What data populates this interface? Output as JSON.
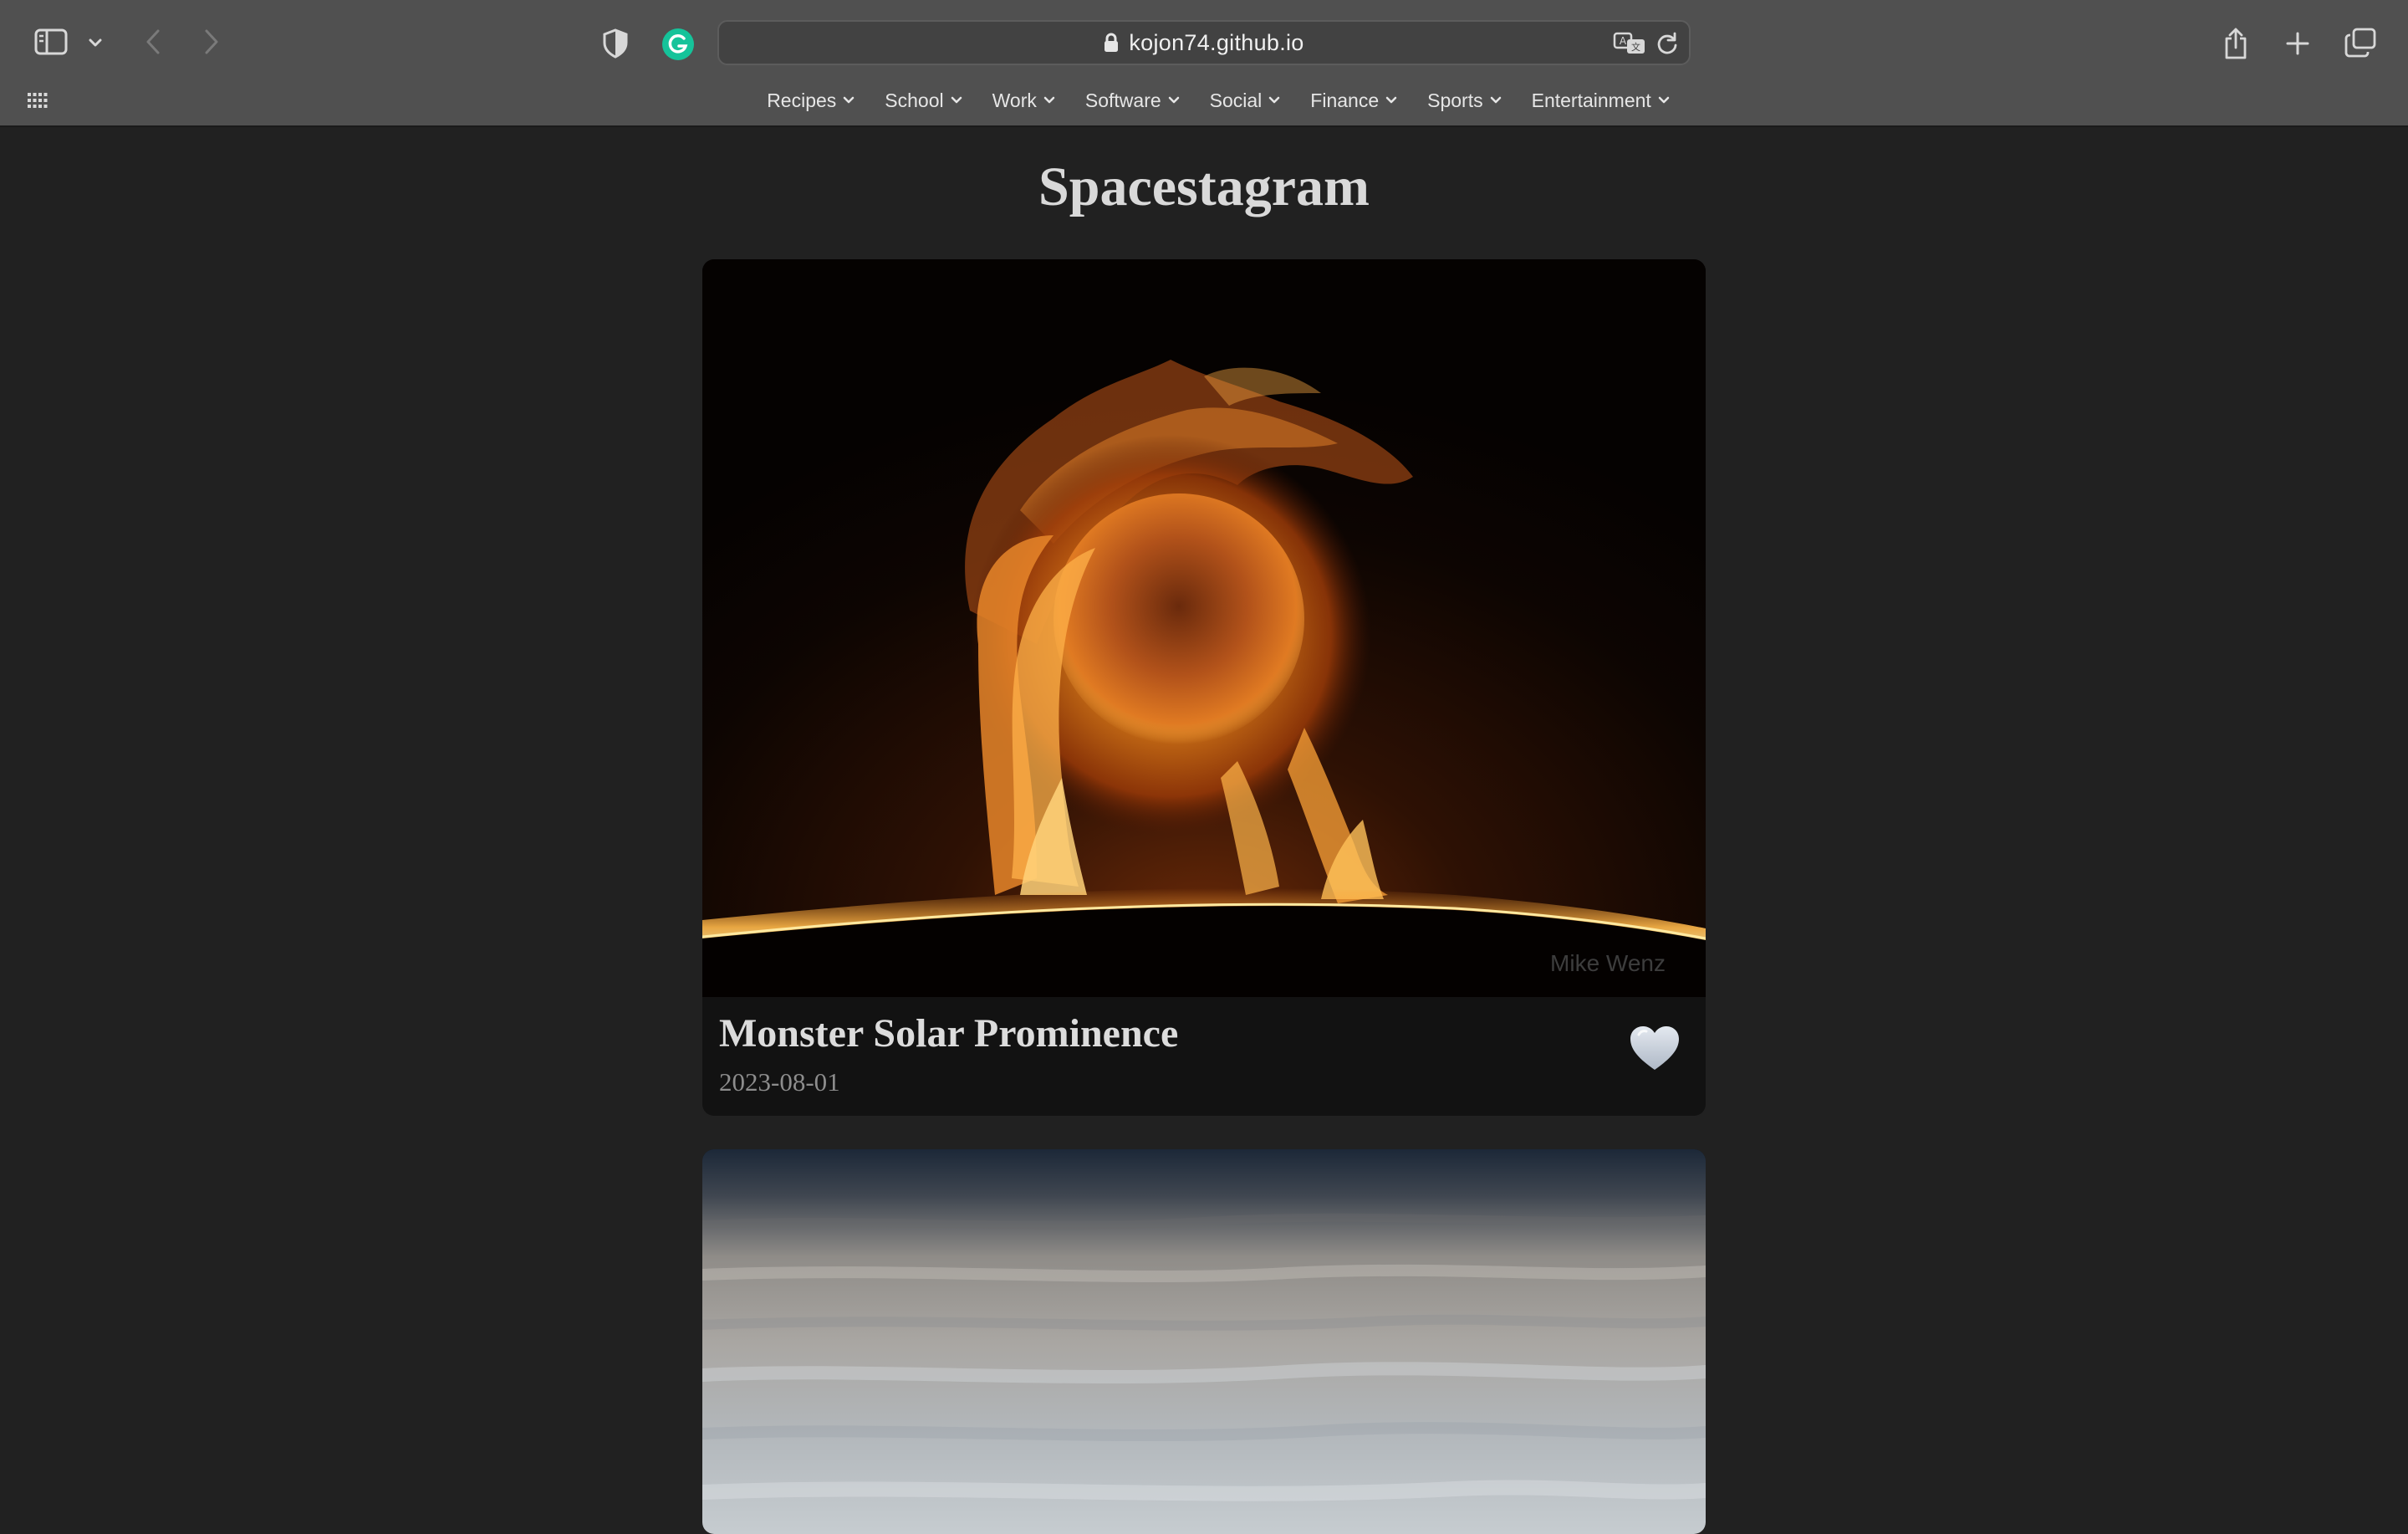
{
  "browser": {
    "url": "kojon74.github.io",
    "favorites": [
      {
        "label": "Recipes"
      },
      {
        "label": "School"
      },
      {
        "label": "Work"
      },
      {
        "label": "Software"
      },
      {
        "label": "Social"
      },
      {
        "label": "Finance"
      },
      {
        "label": "Sports"
      },
      {
        "label": "Entertainment"
      }
    ]
  },
  "page": {
    "title": "Spacestagram",
    "posts": [
      {
        "title": "Monster Solar Prominence",
        "date": "2023-08-01",
        "credit": "Mike Wenz",
        "liked": false
      }
    ]
  },
  "colors": {
    "page_bg": "#212121",
    "toolbar_bg": "#505050",
    "card_bg": "#121212",
    "grammarly": "#15c39a",
    "heart": "#c9d3df"
  }
}
